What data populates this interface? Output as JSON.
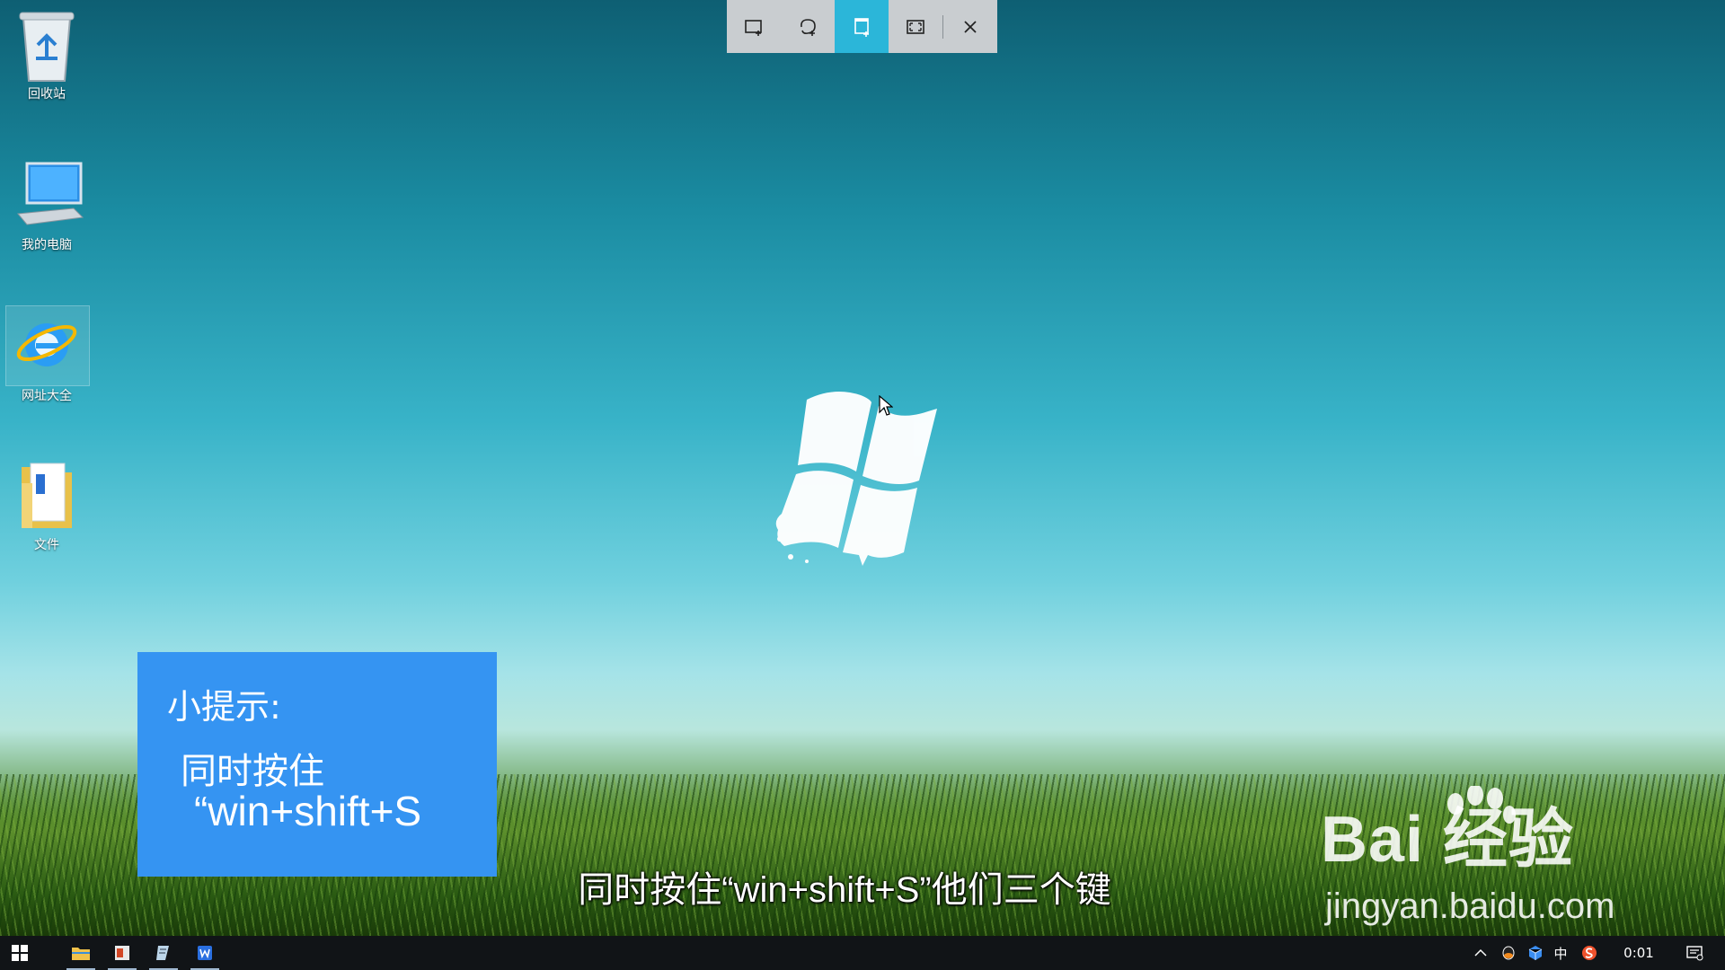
{
  "desktop": {
    "icons": [
      {
        "label": "回收站",
        "icon": "recycle-bin-icon"
      },
      {
        "label": "我的电脑",
        "icon": "computer-icon"
      },
      {
        "label": "网址大全",
        "icon": "ie-browser-icon"
      },
      {
        "label": "文件",
        "icon": "folder-icon"
      }
    ]
  },
  "snip_toolbar": {
    "buttons": [
      {
        "icon": "rectangular-snip-icon"
      },
      {
        "icon": "freeform-snip-icon"
      },
      {
        "icon": "window-snip-icon",
        "active": true
      },
      {
        "icon": "fullscreen-snip-icon"
      },
      {
        "icon": "close-icon"
      }
    ],
    "active_color": "#2bb6d9"
  },
  "tip_box": {
    "heading": "小提示:",
    "line1": "同时按住",
    "line2": "“win+shift+S",
    "background": "#3594f2"
  },
  "subtitle": "同时按住“win+shift+S”他们三个键",
  "watermark": {
    "brand": "Bai 经验",
    "url": "jingyan.baidu.com"
  },
  "taskbar": {
    "pinned": [
      "start-icon",
      "file-explorer-icon",
      "office-icon",
      "notepad-icon",
      "wps-writer-icon"
    ],
    "tray": {
      "ime": "中",
      "clock": "0:01"
    }
  }
}
